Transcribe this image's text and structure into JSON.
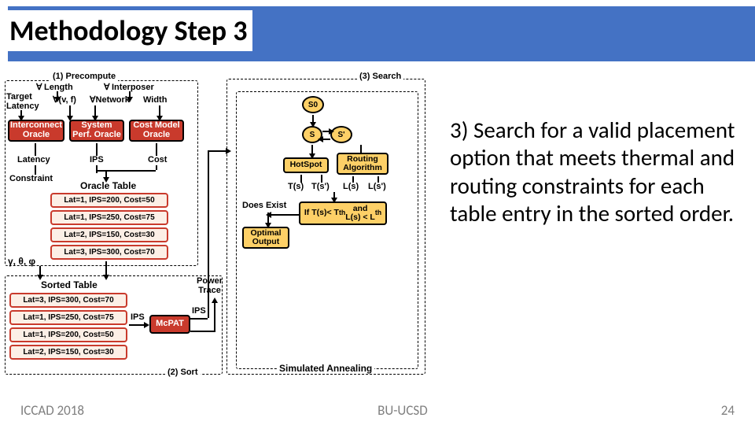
{
  "title": "Methodology Step 3",
  "description": "3) Search for a valid placement option that meets thermal and routing constraints for each table entry in the sorted order.",
  "footer": {
    "left": "ICCAD 2018",
    "center": "BU-UCSD",
    "right": "24"
  },
  "diagram": {
    "precompute": {
      "header": "(1) Precompute",
      "length": "Length",
      "interposer": "Interposer",
      "target_latency": "Target\nLatency",
      "vf": "∀(v, f)",
      "network": "∀Network",
      "width": "Width",
      "interconnect": "Interconnect\nOracle",
      "sys_perf": "System\nPerf. Oracle",
      "cost_model": "Cost Model\nOracle",
      "latency": "Latency",
      "ips": "IPS",
      "cost": "Cost",
      "constraint": "Constraint",
      "oracle_table": "Oracle Table",
      "rows": [
        "Lat=1, IPS=200, Cost=50",
        "Lat=1, IPS=250, Cost=75",
        "Lat=2, IPS=150, Cost=30",
        "Lat=3, IPS=300, Cost=70"
      ],
      "ytp": "γ, θ, φ"
    },
    "sort": {
      "header": "(2) Sort",
      "sorted_table": "Sorted Table",
      "rows": [
        "Lat=3, IPS=300, Cost=70",
        "Lat=1, IPS=250, Cost=75",
        "Lat=1, IPS=200, Cost=50",
        "Lat=2, IPS=150, Cost=30"
      ],
      "mcpat": "McPAT",
      "ips": "IPS",
      "ips2": "IPS",
      "power_trace": "Power\nTrace"
    },
    "search": {
      "header": "(3) Search",
      "s0": "S0",
      "s": "S",
      "sp": "S'",
      "hotspot": "HotSpot",
      "routing": "Routing\nAlgorithm",
      "ts": "T(s)",
      "tsp": "T(s')",
      "ls": "L(s)",
      "lsp": "L(s')",
      "cond": "If T(s)< Tth and\nL(s) < Lth",
      "does_exist": "Does Exist",
      "optimal": "Optimal\nOutput",
      "sa": "Simulated Annealing"
    }
  }
}
